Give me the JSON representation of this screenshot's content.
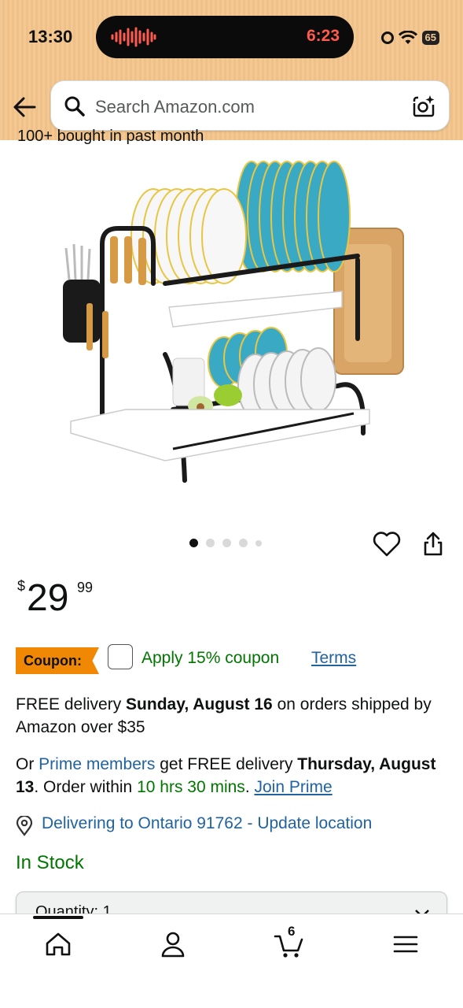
{
  "status_bar": {
    "time": "13:30",
    "recording_time": "6:23",
    "battery": "65"
  },
  "search": {
    "placeholder": "Search Amazon.com"
  },
  "partial_top_text": "100+ bought in past month",
  "image_carousel": {
    "count": 5,
    "active_index": 0
  },
  "price": {
    "currency": "$",
    "whole": "29",
    "fraction": "99"
  },
  "coupon": {
    "badge": "Coupon:",
    "apply": "Apply 15% coupon",
    "terms": "Terms"
  },
  "delivery": {
    "free_prefix": "FREE delivery ",
    "free_date": "Sunday, August 16",
    "free_suffix": " on orders shipped by Amazon over $35",
    "prime_or": "Or ",
    "prime_members": "Prime members",
    "prime_get": " get FREE delivery ",
    "prime_date": "Thursday, August 13",
    "order_within": ". Order within ",
    "countdown": "10 hrs 30 mins",
    "period": ". ",
    "join_prime": "Join Prime"
  },
  "location": {
    "text": "Delivering to Ontario 91762 - Update location"
  },
  "stock": "In Stock",
  "quantity": {
    "label": "Quantity: 1"
  },
  "bottom_nav": {
    "cart_count": "6"
  },
  "colors": {
    "header_bg": "#f3c892",
    "link": "#2162a1",
    "green": "#007600",
    "coupon": "#f08804"
  }
}
